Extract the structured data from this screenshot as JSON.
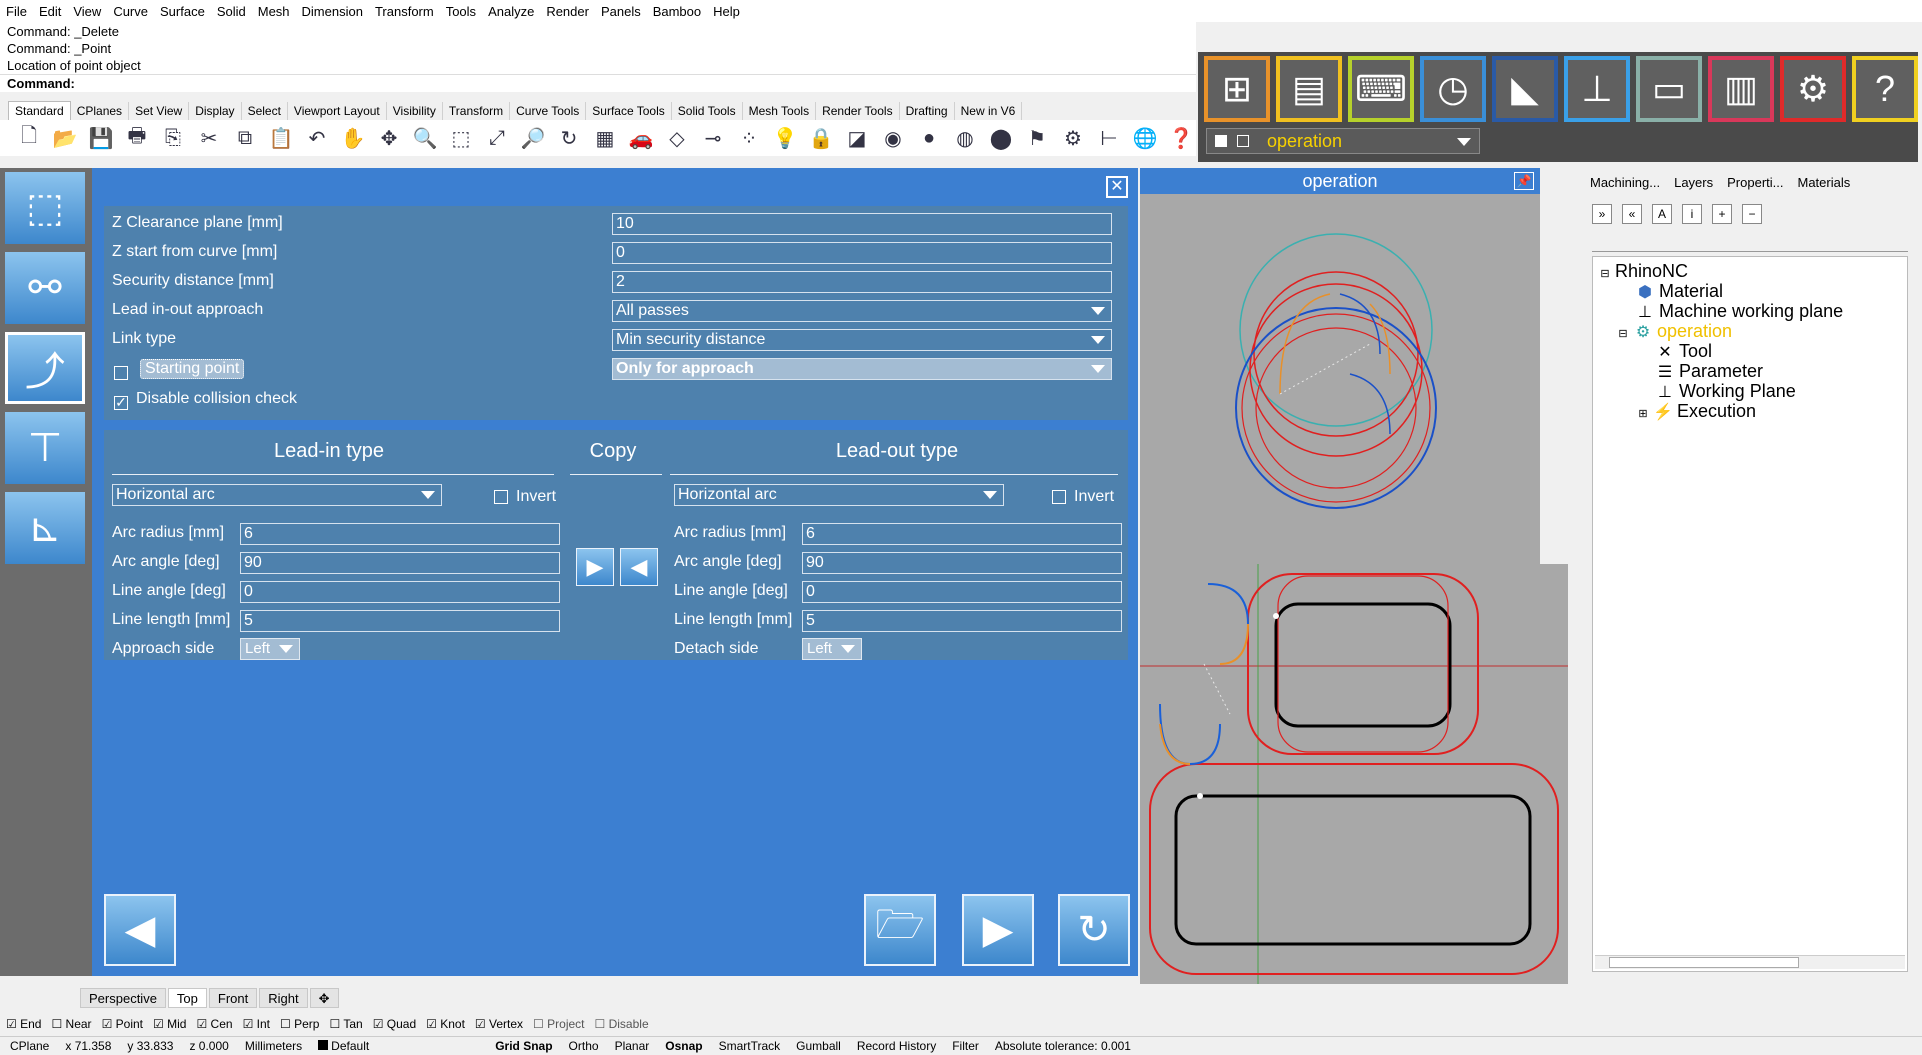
{
  "menu": [
    "File",
    "Edit",
    "View",
    "Curve",
    "Surface",
    "Solid",
    "Mesh",
    "Dimension",
    "Transform",
    "Tools",
    "Analyze",
    "Render",
    "Panels",
    "Bamboo",
    "Help"
  ],
  "command_history": [
    "Command: _Delete",
    "Command: _Point",
    "Location of point object"
  ],
  "command_prompt": "Command:",
  "toolbar_tabs": [
    "Standard",
    "CPlanes",
    "Set View",
    "Display",
    "Select",
    "Viewport Layout",
    "Visibility",
    "Transform",
    "Curve Tools",
    "Surface Tools",
    "Solid Tools",
    "Mesh Tools",
    "Render Tools",
    "Drafting",
    "New in V6"
  ],
  "operation_selector": "operation",
  "form": {
    "z_clearance_label": "Z Clearance plane [mm]",
    "z_clearance_value": "10",
    "z_start_label": "Z start from curve [mm]",
    "z_start_value": "0",
    "security_label": "Security distance [mm]",
    "security_value": "2",
    "lead_approach_label": "Lead in-out approach",
    "lead_approach_value": "All passes",
    "link_type_label": "Link type",
    "link_type_value": "Min security distance",
    "starting_point_label": "Starting point",
    "starting_point_value": "Only for approach",
    "disable_collision_label": "Disable collision check"
  },
  "leadin": {
    "title": "Lead-in type",
    "type": "Horizontal arc",
    "invert": "Invert",
    "arc_radius_label": "Arc radius [mm]",
    "arc_radius": "6",
    "arc_angle_label": "Arc angle [deg]",
    "arc_angle": "90",
    "line_angle_label": "Line angle [deg]",
    "line_angle": "0",
    "line_length_label": "Line length [mm]",
    "line_length": "5",
    "side_label": "Approach side",
    "side": "Left"
  },
  "copy_label": "Copy",
  "leadout": {
    "title": "Lead-out type",
    "type": "Horizontal arc",
    "invert": "Invert",
    "arc_radius_label": "Arc radius [mm]",
    "arc_radius": "6",
    "arc_angle_label": "Arc angle [deg]",
    "arc_angle": "90",
    "line_angle_label": "Line angle [deg]",
    "line_angle": "0",
    "line_length_label": "Line length [mm]",
    "line_length": "5",
    "side_label": "Detach side",
    "side": "Left"
  },
  "viewport_title": "operation",
  "panel_tabs": [
    "Machining...",
    "Layers",
    "Properti...",
    "Materials"
  ],
  "tree": {
    "root": "RhinoNC",
    "material": "Material",
    "mwp": "Machine working plane",
    "operation": "operation",
    "tool": "Tool",
    "parameter": "Parameter",
    "working_plane": "Working Plane",
    "execution": "Execution"
  },
  "viewport_tabs": [
    "Perspective",
    "Top",
    "Front",
    "Right"
  ],
  "osnaps": [
    "End",
    "Near",
    "Point",
    "Mid",
    "Cen",
    "Int",
    "Perp",
    "Tan",
    "Quad",
    "Knot",
    "Vertex",
    "Project",
    "Disable"
  ],
  "status": {
    "cplane": "CPlane",
    "x": "x 71.358",
    "y": "y 33.833",
    "z": "z 0.000",
    "units": "Millimeters",
    "layer": "Default",
    "grid_snap": "Grid Snap",
    "ortho": "Ortho",
    "planar": "Planar",
    "osnap": "Osnap",
    "smarttrack": "SmartTrack",
    "gumball": "Gumball",
    "record": "Record History",
    "filter": "Filter",
    "tolerance": "Absolute tolerance: 0.001"
  }
}
